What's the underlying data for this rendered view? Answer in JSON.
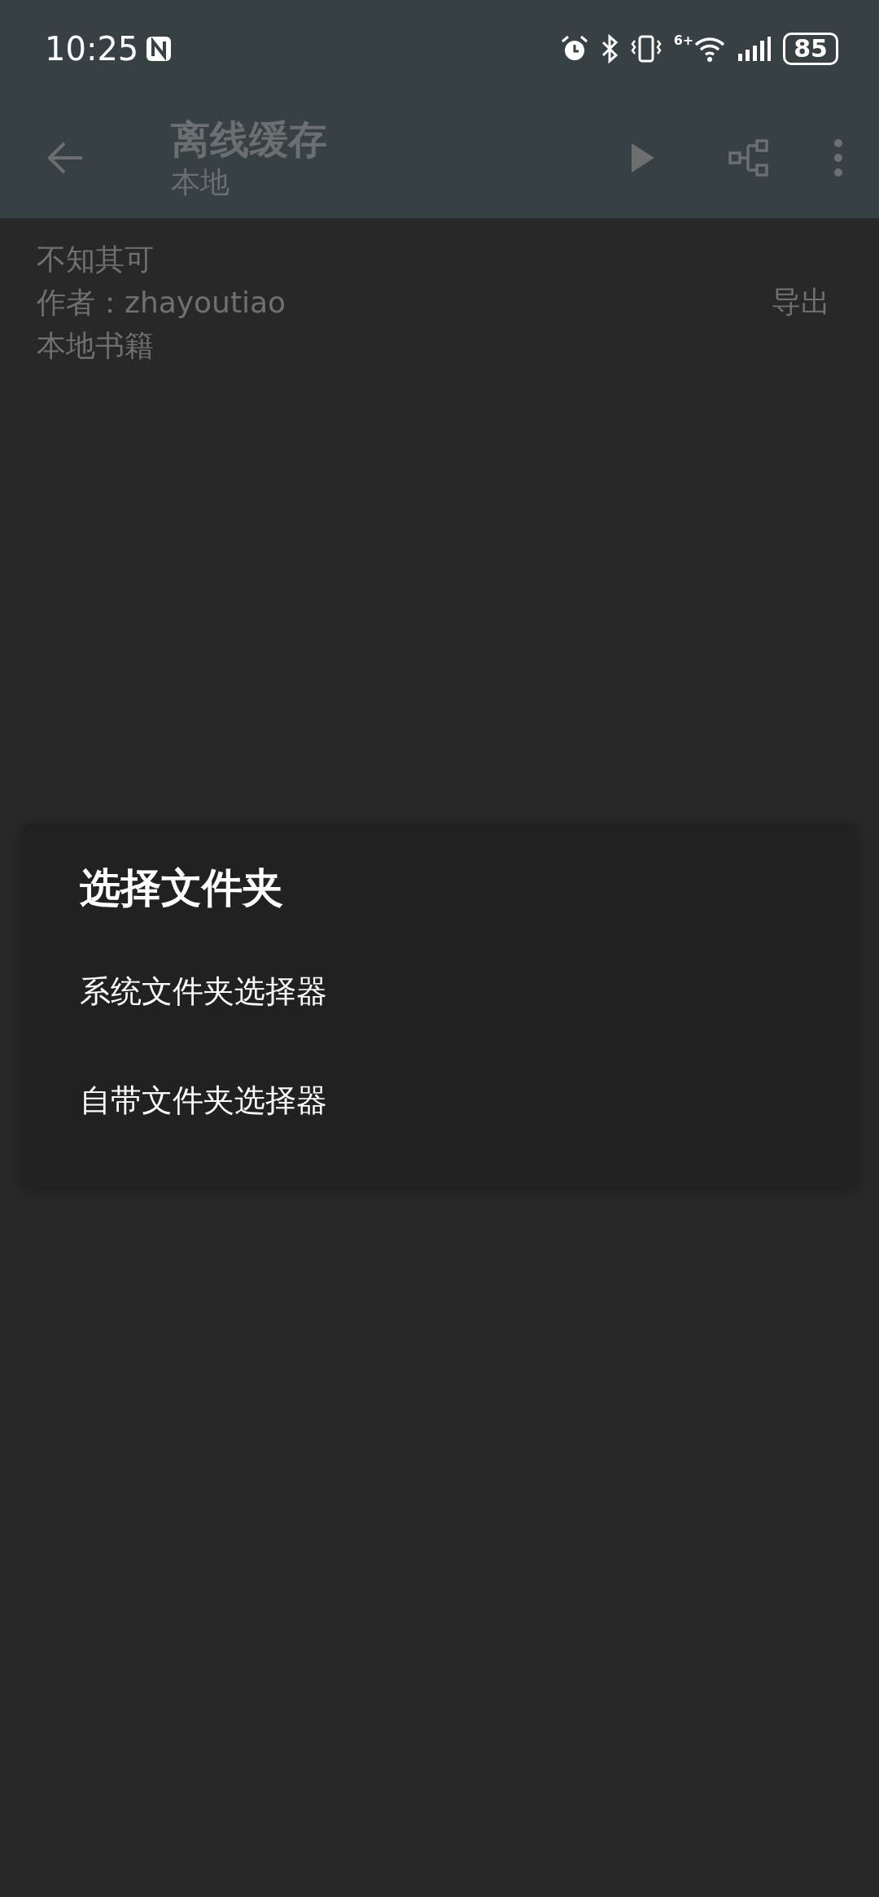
{
  "status_bar": {
    "time": "10:25",
    "wifi_badge": "6+",
    "battery": "85"
  },
  "app_bar": {
    "title": "离线缓存",
    "subtitle": "本地"
  },
  "book": {
    "title": "不知其可",
    "author": "作者：zhayoutiao",
    "source": "本地书籍",
    "action": "导出"
  },
  "dialog": {
    "title": "选择文件夹",
    "options": [
      {
        "label": "系统文件夹选择器"
      },
      {
        "label": "自带文件夹选择器"
      }
    ]
  }
}
